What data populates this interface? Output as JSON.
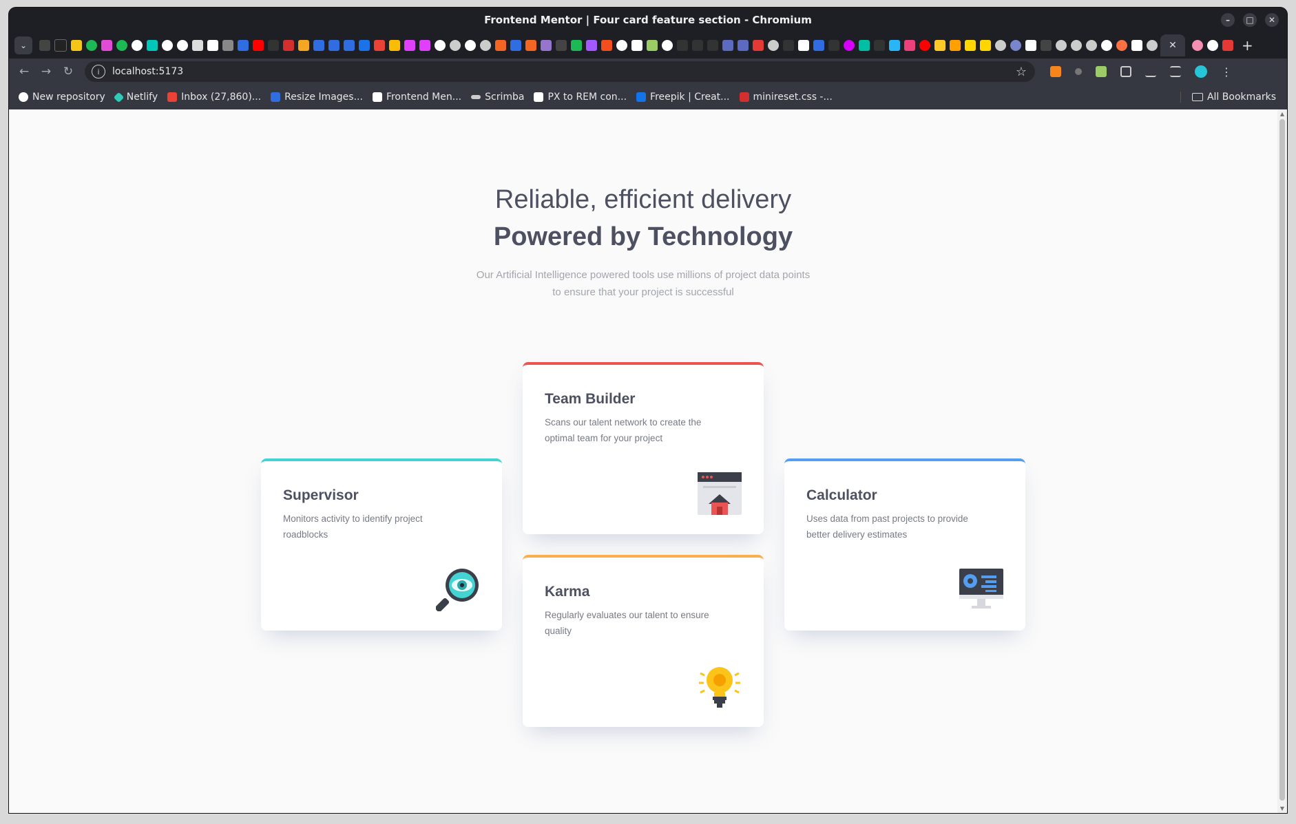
{
  "browser": {
    "window_title": "Frontend Mentor | Four card feature section - Chromium",
    "url": "localhost:5173",
    "tab_close": "✕",
    "new_tab": "+",
    "bookmarks": [
      {
        "label": "New repository",
        "color": "#ffffff"
      },
      {
        "label": "Netlify",
        "color": "#32c9b6"
      },
      {
        "label": "Inbox (27,860)...",
        "color": "#ea4335"
      },
      {
        "label": "Resize Images...",
        "color": "#2f6de1"
      },
      {
        "label": "Frontend Men...",
        "color": "#ffffff"
      },
      {
        "label": "Scrimba",
        "color": "#ffffff"
      },
      {
        "label": "PX to REM con...",
        "color": "#ffffff"
      },
      {
        "label": "Freepik | Creat...",
        "color": "#1273eb"
      },
      {
        "label": "minireset.css -...",
        "color": "#d32f2f"
      }
    ],
    "all_bookmarks": "All Bookmarks"
  },
  "page": {
    "heading_light": "Reliable, efficient delivery",
    "heading_bold": "Powered by Technology",
    "intro": "Our Artificial Intelligence powered tools use millions of project data points to ensure that your project is successful",
    "cards": [
      {
        "title": "Supervisor",
        "desc": "Monitors activity to identify project roadblocks",
        "accent": "#44d3d2",
        "icon": "magnifier-eye-icon"
      },
      {
        "title": "Team Builder",
        "desc": "Scans our talent network to create the optimal team for your project",
        "accent": "#ea5454",
        "icon": "browser-house-icon"
      },
      {
        "title": "Karma",
        "desc": "Regularly evaluates our talent to ensure quality",
        "accent": "#fcae4a",
        "icon": "lightbulb-icon"
      },
      {
        "title": "Calculator",
        "desc": "Uses data from past projects to provide better delivery estimates",
        "accent": "#549ef2",
        "icon": "monitor-dashboard-icon"
      }
    ]
  }
}
